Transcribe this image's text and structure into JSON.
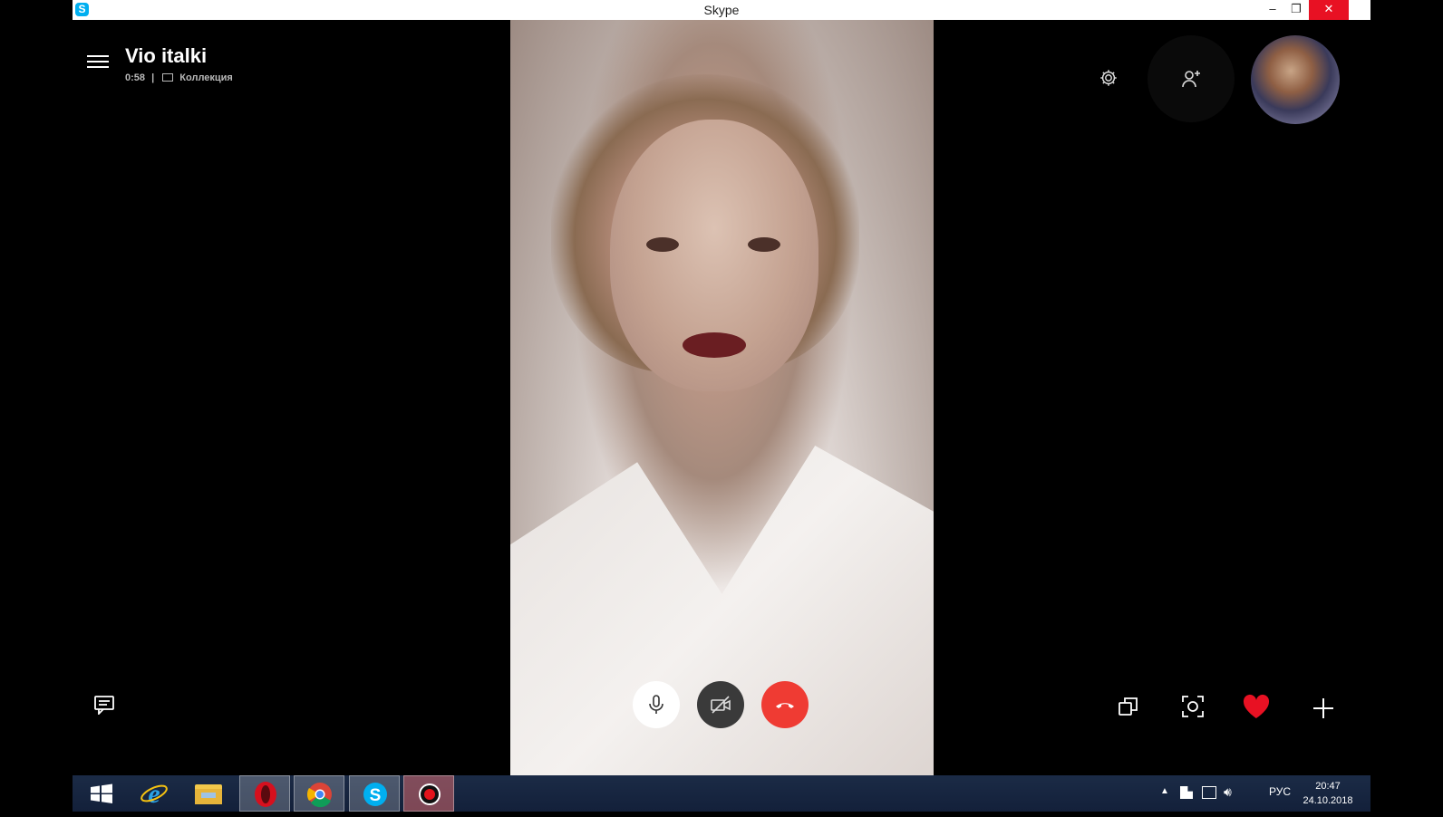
{
  "window": {
    "title": "Skype",
    "app_icon_letter": "S",
    "minimize_glyph": "–",
    "restore_glyph": "❐",
    "close_glyph": "✕"
  },
  "call": {
    "contact_name": "Vio italki",
    "duration": "0:58",
    "separator": "|",
    "group_label": "Коллекция"
  },
  "controls": {
    "mic": "microphone-icon",
    "camera": "video-off-icon",
    "end": "end-call-icon",
    "chat": "chat-icon",
    "switch": "switch-camera-icon",
    "snapshot": "snapshot-icon",
    "react": "heart-icon",
    "more": "plus-icon",
    "settings": "gear-icon",
    "add_participant": "add-person-icon"
  },
  "colors": {
    "end_call": "#ef3b33",
    "heart": "#e81123",
    "skype_blue": "#00aff0",
    "taskbar": "#1b2b46"
  },
  "taskbar": {
    "apps": [
      "windows-start",
      "internet-explorer",
      "file-explorer",
      "opera",
      "chrome",
      "skype",
      "recorder"
    ],
    "tray_lang": "РУС",
    "time": "20:47",
    "date": "24.10.2018"
  }
}
